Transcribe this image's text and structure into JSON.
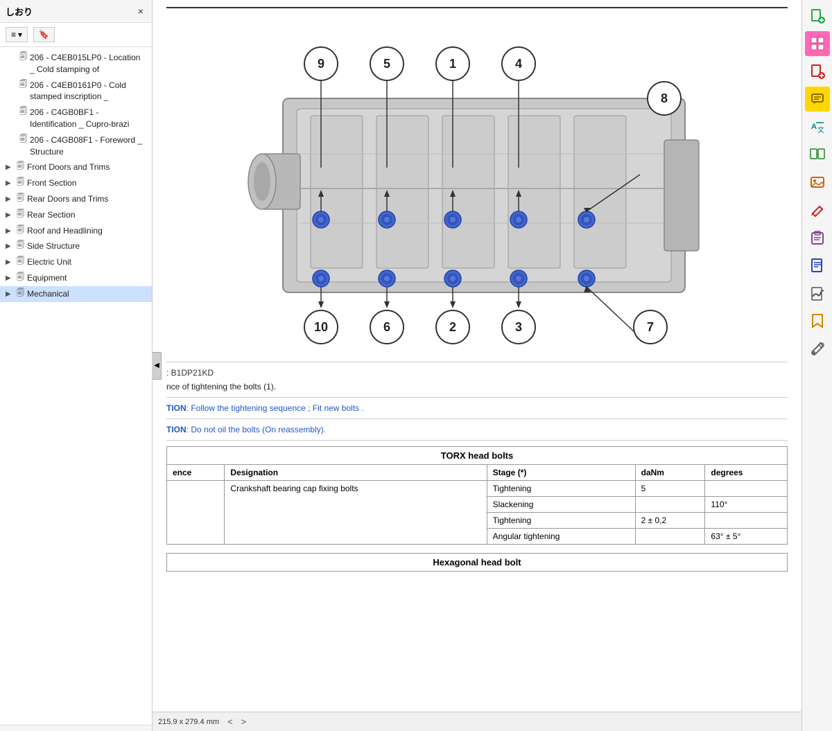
{
  "sidebar": {
    "title": "しおり",
    "close_label": "×",
    "toolbar": {
      "view_btn": "≡▾",
      "bookmark_btn": "🔖"
    },
    "tree_items": [
      {
        "id": "item1",
        "label": "206 - C4EB015LP0 - Location _ Cold stamping of",
        "icon": "📄",
        "indent": 1,
        "active": false
      },
      {
        "id": "item2",
        "label": "206 - C4EB0161P0 - Cold stamped inscription _",
        "icon": "📄",
        "indent": 1,
        "active": false
      },
      {
        "id": "item3",
        "label": "206 - C4GB0BF1 - Identification _ Cupro-brazi",
        "icon": "📄",
        "indent": 1,
        "active": false
      },
      {
        "id": "item4",
        "label": "206 - C4GB08F1 - Foreword _ Structure",
        "icon": "📄",
        "indent": 1,
        "active": false
      },
      {
        "id": "front-doors",
        "label": "Front Doors and Trims",
        "icon": "📁",
        "indent": 0,
        "chevron": "▶",
        "active": false
      },
      {
        "id": "front-section",
        "label": "Front Section",
        "icon": "📁",
        "indent": 0,
        "chevron": "▶",
        "active": false
      },
      {
        "id": "rear-doors",
        "label": "Rear Doors and Trims",
        "icon": "📁",
        "indent": 0,
        "chevron": "▶",
        "active": false
      },
      {
        "id": "rear-section",
        "label": "Rear Section",
        "icon": "📁",
        "indent": 0,
        "chevron": "▶",
        "active": false
      },
      {
        "id": "roof",
        "label": "Roof and Headlining",
        "icon": "📁",
        "indent": 0,
        "chevron": "▶",
        "active": false
      },
      {
        "id": "side-structure",
        "label": "Side Structure",
        "icon": "📁",
        "indent": 0,
        "chevron": "▶",
        "active": false
      },
      {
        "id": "electric-unit",
        "label": "Electric Unit",
        "icon": "📁",
        "indent": 0,
        "chevron": "▶",
        "active": false
      },
      {
        "id": "equipment",
        "label": "Equipment",
        "icon": "📁",
        "indent": 0,
        "chevron": "▶",
        "active": false
      },
      {
        "id": "mechanical",
        "label": "Mechanical",
        "icon": "📁",
        "indent": 0,
        "chevron": "▶",
        "active": true
      }
    ],
    "footer": {
      "page_size": "215.9 x 279.4 mm"
    }
  },
  "content": {
    "ref_code": ": B1DP21KD",
    "body_text": "nce of tightening the bolts (1).",
    "caution1_label": "TION",
    "caution1_text": ": Follow the tightening sequence ; Fit new bolts .",
    "caution2_label": "TION",
    "caution2_text": ": Do not oil the bolts (On reassembly).",
    "table": {
      "title": "TORX head bolts",
      "columns": [
        "ence",
        "Designation",
        "Stage (*)",
        "daNm",
        "degrees"
      ],
      "rows": [
        {
          "sequence": "",
          "designation": "Crankshaft bearing cap fixing bolts",
          "stages": [
            {
              "stage": "Tightening",
              "daNm": "5",
              "degrees": ""
            },
            {
              "stage": "Slackening",
              "daNm": "",
              "degrees": "110°"
            },
            {
              "stage": "Tightening",
              "daNm": "2 ± 0,2",
              "degrees": ""
            },
            {
              "stage": "Angular tightening",
              "daNm": "",
              "degrees": "63° ± 5°"
            }
          ]
        }
      ]
    },
    "next_table_title": "Hexagonal head bolt"
  },
  "bottom_bar": {
    "page_size_label": "215.9 x 279.4 mm",
    "nav_left": "<",
    "nav_right": ">"
  },
  "right_toolbar": {
    "buttons": [
      {
        "id": "btn1",
        "icon": "📥",
        "color": "green",
        "label": "download"
      },
      {
        "id": "btn2",
        "icon": "⊞",
        "color": "pink",
        "label": "layout"
      },
      {
        "id": "btn3",
        "icon": "🗎",
        "color": "red",
        "label": "add-document"
      },
      {
        "id": "btn4",
        "icon": "💬",
        "color": "yellow-active",
        "label": "comment"
      },
      {
        "id": "btn5",
        "icon": "🔤",
        "color": "teal",
        "label": "translate"
      },
      {
        "id": "btn6",
        "icon": "⊡",
        "color": "green2",
        "label": "compare"
      },
      {
        "id": "btn7",
        "icon": "🖼",
        "color": "orange",
        "label": "image"
      },
      {
        "id": "btn8",
        "icon": "✏",
        "color": "red2",
        "label": "edit"
      },
      {
        "id": "btn9",
        "icon": "📋",
        "color": "purple",
        "label": "clipboard"
      },
      {
        "id": "btn10",
        "icon": "📄",
        "color": "blue",
        "label": "page"
      },
      {
        "id": "btn11",
        "icon": "✍",
        "color": "gray",
        "label": "sign"
      },
      {
        "id": "btn12",
        "icon": "🔖",
        "color": "yellow2",
        "label": "bookmark"
      },
      {
        "id": "btn13",
        "icon": "🔧",
        "color": "gray2",
        "label": "tools"
      }
    ]
  }
}
